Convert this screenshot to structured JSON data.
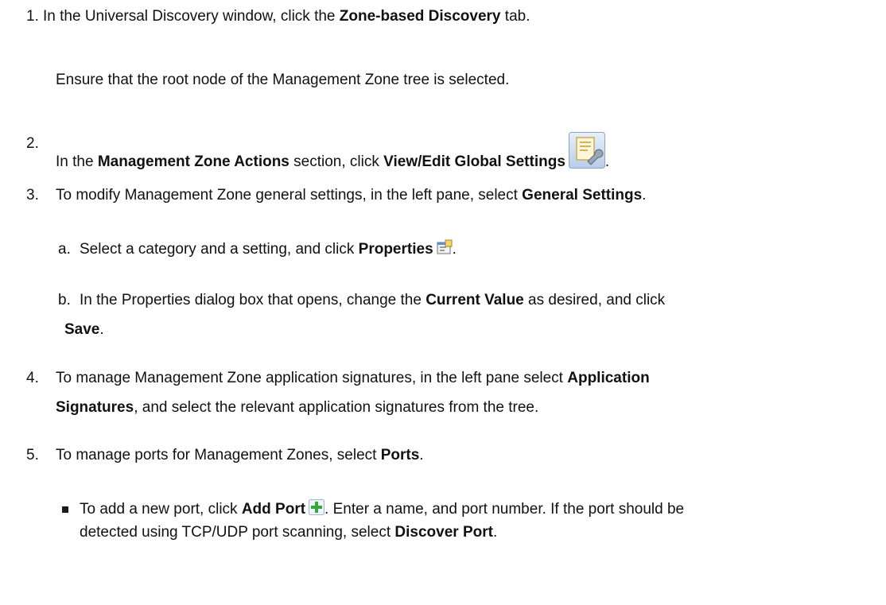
{
  "step1": {
    "number": "1.",
    "pre": "In the Universal Discovery window, click the ",
    "bold": "Zone-based Discovery",
    "post": " tab."
  },
  "step1_note": "Ensure that the root node of the Management Zone tree is selected.",
  "step2": {
    "number": "2.",
    "pre": "In the ",
    "bold1": "Management Zone Actions",
    "mid": " section, click ",
    "bold2": "View/Edit Global Settings",
    "post": ".",
    "icon": "global-settings-icon"
  },
  "step3": {
    "number": "3.",
    "pre": "To modify Management Zone general settings, in the left pane, select ",
    "bold": "General Settings",
    "post": "."
  },
  "step3a": {
    "letter": "a.",
    "pre": "Select a category and a setting, and click ",
    "bold": "Properties",
    "post": ".",
    "icon": "properties-icon"
  },
  "step3b": {
    "letter": "b.",
    "pre": "In the Properties dialog box that opens, change the ",
    "bold1": "Current Value",
    "mid": " as desired, and click",
    "bold2": "Save",
    "post": "."
  },
  "step4": {
    "number": "4.",
    "pre": "To manage Management Zone application signatures, in the left pane select ",
    "bold1": "Application",
    "bold2": "Signatures",
    "post": ", and select the relevant application signatures from the tree."
  },
  "step5": {
    "number": "5.",
    "pre": "To manage ports for Management Zones, select ",
    "bold": "Ports",
    "post": "."
  },
  "step5_bullet": {
    "pre": "To add a new port, click ",
    "bold1": "Add Port",
    "mid": ". Enter a name, and port number. If the port should be",
    "line2_pre": "detected using TCP/UDP port scanning, select ",
    "bold2": "Discover Port",
    "post": ".",
    "icon": "add-port-icon"
  },
  "colors": {
    "text": "#111111",
    "icon_green": "#3aa53a",
    "icon_blue": "#5b8fd6"
  }
}
